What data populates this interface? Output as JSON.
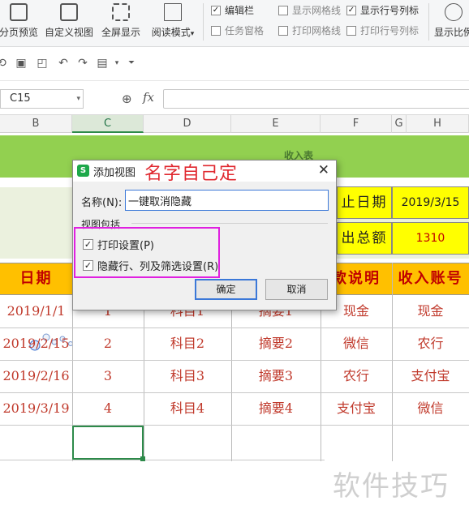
{
  "ribbon": {
    "buttons": [
      {
        "label": "分页预览",
        "icon": "page-break-preview-icon"
      },
      {
        "label": "自定义视图",
        "icon": "custom-view-icon"
      },
      {
        "label": "全屏显示",
        "icon": "fullscreen-icon"
      },
      {
        "label": "阅读模式",
        "icon": "reading-mode-icon",
        "dropdown": "▾"
      },
      {
        "label": "显示比例",
        "icon": "zoom-icon"
      }
    ],
    "checkboxes": [
      {
        "label": "编辑栏",
        "checked": true
      },
      {
        "label": "显示网格线",
        "checked": false
      },
      {
        "label": "显示行号列标",
        "checked": true
      },
      {
        "label": "任务窗格",
        "checked": false
      },
      {
        "label": "打印网格线",
        "checked": false
      },
      {
        "label": "打印行号列标",
        "checked": false
      }
    ]
  },
  "formula_bar": {
    "cell_ref": "C15",
    "fx": "fx",
    "value": ""
  },
  "columns": [
    "B",
    "C",
    "D",
    "E",
    "F",
    "G",
    "H"
  ],
  "sheet": {
    "title_partial": "收入表",
    "deadline_label": "止日期",
    "deadline_value": "2019/3/15",
    "total_label": "出总额",
    "total_value": "1310",
    "headers": [
      "日期",
      "",
      "",
      "",
      "款说明",
      "收入账号"
    ],
    "rows": [
      {
        "date": "2019/1/1",
        "no": "1",
        "subject": "科目1",
        "summary": "摘要1",
        "method": "现金",
        "account": "现金"
      },
      {
        "date": "2019/2/15",
        "no": "2",
        "subject": "科目2",
        "summary": "摘要2",
        "method": "微信",
        "account": "农行"
      },
      {
        "date": "2019/2/16",
        "no": "3",
        "subject": "科目3",
        "summary": "摘要3",
        "method": "农行",
        "account": "支付宝"
      },
      {
        "date": "2019/3/19",
        "no": "4",
        "subject": "科目4",
        "summary": "摘要4",
        "method": "支付宝",
        "account": "微信"
      }
    ]
  },
  "dialog": {
    "logo": "S",
    "title": "添加视图",
    "close": "✕",
    "name_label": "名称(N):",
    "name_value": "一键取消隐藏",
    "group_label": "视图包括",
    "options": [
      {
        "label": "打印设置(P)",
        "checked": true
      },
      {
        "label": "隐藏行、列及筛选设置(R)",
        "checked": true
      }
    ],
    "ok": "确定",
    "cancel": "取消"
  },
  "annotation": "名字自己定",
  "watermark": "软件技巧",
  "colors": {
    "ribbon_bg": "#f5f6f7",
    "green_band": "#92d050",
    "light_band": "#ebf1de",
    "header_row": "#ffc000",
    "highlight_cell": "#ffff00",
    "data_text": "#c0392b",
    "annotation": "#e0282f",
    "magenta_box": "#e020e0",
    "selection": "#2d8a4a"
  }
}
